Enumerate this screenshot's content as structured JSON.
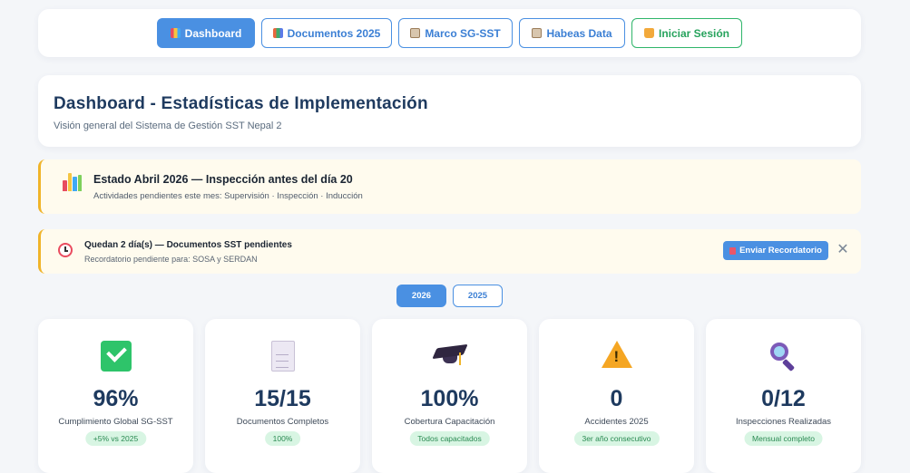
{
  "nav": {
    "items": [
      {
        "label": "Dashboard",
        "icon": "bar-chart-icon",
        "active": true
      },
      {
        "label": "Documentos 2025",
        "icon": "books-icon",
        "active": false
      },
      {
        "label": "Marco SG-SST",
        "icon": "clipboard-icon",
        "active": false
      },
      {
        "label": "Habeas Data",
        "icon": "clipboard-icon",
        "active": false
      },
      {
        "label": "Iniciar Sesión",
        "icon": "lock-icon",
        "active": false
      }
    ]
  },
  "header": {
    "title": "Dashboard - Estadísticas de Implementación",
    "subtitle": "Visión general del Sistema de Gestión SST Nepal 2"
  },
  "alert_status": {
    "icon": "bar-chart-icon",
    "title": "Estado Abril 2026 — Inspección antes del día 20",
    "subtitle": "Actividades pendientes este mes: Supervisión · Inspección · Inducción"
  },
  "alert_reminder": {
    "icon": "alarm-clock-icon",
    "title": "Quedan 2 día(s) — Documentos SST pendientes",
    "subtitle": "Recordatorio pendiente para: SOSA y SERDAN",
    "button_label": "Enviar Recordatorio",
    "close_label": "✕"
  },
  "year_toggle": {
    "options": [
      "2026",
      "2025"
    ],
    "selected": "2026"
  },
  "stats": [
    {
      "icon": "check-mark-icon",
      "value": "96%",
      "label": "Cumplimiento Global SG-SST",
      "badge": "+5% vs 2025"
    },
    {
      "icon": "document-icon",
      "value": "15/15",
      "label": "Documentos Completos",
      "badge": "100%"
    },
    {
      "icon": "graduation-cap-icon",
      "value": "100%",
      "label": "Cobertura Capacitación",
      "badge": "Todos capacitados"
    },
    {
      "icon": "warning-icon",
      "value": "0",
      "label": "Accidentes 2025",
      "badge": "3er año consecutivo"
    },
    {
      "icon": "magnifying-glass-icon",
      "value": "0/12",
      "label": "Inspecciones Realizadas",
      "badge": "Mensual completo"
    }
  ],
  "colors": {
    "primary": "#4a90e2",
    "heading": "#1e3a5f",
    "success": "#2fb56a",
    "alert_border": "#f0b429",
    "alert_bg": "#fffbee",
    "badge_bg": "#d8f5e3"
  }
}
